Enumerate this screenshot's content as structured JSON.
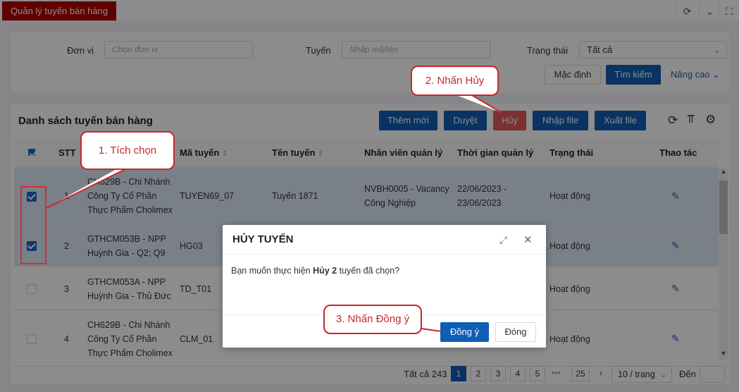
{
  "app_tab": "Quản lý tuyến bán hàng",
  "filters": {
    "don_vi_label": "Đơn vị",
    "don_vi_placeholder": "Chọn đơn vị",
    "tuyen_label": "Tuyến",
    "tuyen_placeholder": "Nhập mã/tên",
    "trang_thai_label": "Trạng thái",
    "trang_thai_value": "Tất cả"
  },
  "filter_buttons": {
    "mac_dinh": "Mặc định",
    "tim_kiem": "Tìm kiếm",
    "nang_cao": "Nâng cao"
  },
  "list_title": "Danh sách tuyến bán hàng",
  "actions": {
    "them_moi": "Thêm mới",
    "duyet": "Duyệt",
    "huy": "Hủy",
    "nhap_file": "Nhập file",
    "xuat_file": "Xuất file"
  },
  "columns": [
    "STT",
    "Mã tuyến",
    "Tên tuyến",
    "Nhân viên quản lý",
    "Thời gian quản lý",
    "Trạng thái",
    "Thao tác"
  ],
  "rows": [
    {
      "stt": "1",
      "don_vi": [
        "CH629B - Chi Nhánh",
        "Công Ty Cổ Phần",
        "Thực Phẩm Cholimex"
      ],
      "ma": "TUYEN69_07",
      "ten": "Tuyến 1871",
      "nv": [
        "NVBH0005 - Vacancy",
        "Công Nghiệp"
      ],
      "tg": [
        "22/06/2023 -",
        "23/06/2023"
      ],
      "tt": "Hoạt động",
      "checked": true
    },
    {
      "stt": "2",
      "don_vi": [
        "GTHCM053B - NPP",
        "Huỳnh Gia - Q2; Q9"
      ],
      "ma": "HG03",
      "ten": "",
      "nv": [],
      "tg": [],
      "tt": "Hoạt động",
      "checked": true
    },
    {
      "stt": "3",
      "don_vi": [
        "GTHCM053A - NPP",
        "Huỳnh Gia - Thủ Đức"
      ],
      "ma": "TD_T01",
      "ten": "",
      "nv": [],
      "tg": [],
      "tt": "Hoạt động",
      "checked": false
    },
    {
      "stt": "4",
      "don_vi": [
        "CH629B - Chi Nhánh",
        "Công Ty Cổ Phần",
        "Thực Phẩm Cholimex"
      ],
      "ma": "CLM_01",
      "ten": "",
      "nv": [],
      "tg": [],
      "tt": "Hoạt động",
      "checked": false
    }
  ],
  "pagination": {
    "total": "Tất cả 243",
    "pages": [
      "1",
      "2",
      "3",
      "4",
      "5"
    ],
    "ellipsis": "•••",
    "last": "25",
    "page_size": "10 / trang",
    "goto_label": "Đến"
  },
  "modal": {
    "title": "HỦY TUYẾN",
    "msg_pre": "Bạn muốn thực hiện ",
    "msg_bold": "Hủy 2",
    "msg_post": " tuyến đã chọn?",
    "ok": "Đồng ý",
    "close": "Đóng"
  },
  "callouts": {
    "step1": "1. Tích chọn",
    "step2": "2. Nhấn Hủy",
    "step3": "3. Nhấn Đồng ý"
  },
  "colors": {
    "primary": "#0f5db5",
    "accent_red": "#c62828"
  }
}
